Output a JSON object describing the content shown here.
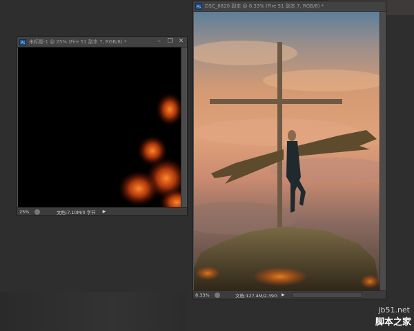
{
  "window_left": {
    "title": "未标题-1 @ 25% (Fire 51 副本 7, RGB/8) *",
    "zoom": "25%",
    "doc_info": "文档:7.10M/0 字节"
  },
  "window_right": {
    "title": "DSC_6820 副本 @ 8.33% (Fire 51 副本 7, RGB/8) *",
    "zoom": "8.33%",
    "doc_info": "文档:127.4M/2.39G"
  },
  "controls": {
    "minimize": "–",
    "maximize": "❐",
    "close": "✕",
    "nav_arrow": "▶"
  },
  "icons": [
    "photoshop-icon",
    "minimize-icon",
    "maximize-icon",
    "close-icon",
    "status-info-icon",
    "arrow-right-icon"
  ],
  "watermark": {
    "url": "jb51.net",
    "name": "脚本之家"
  }
}
